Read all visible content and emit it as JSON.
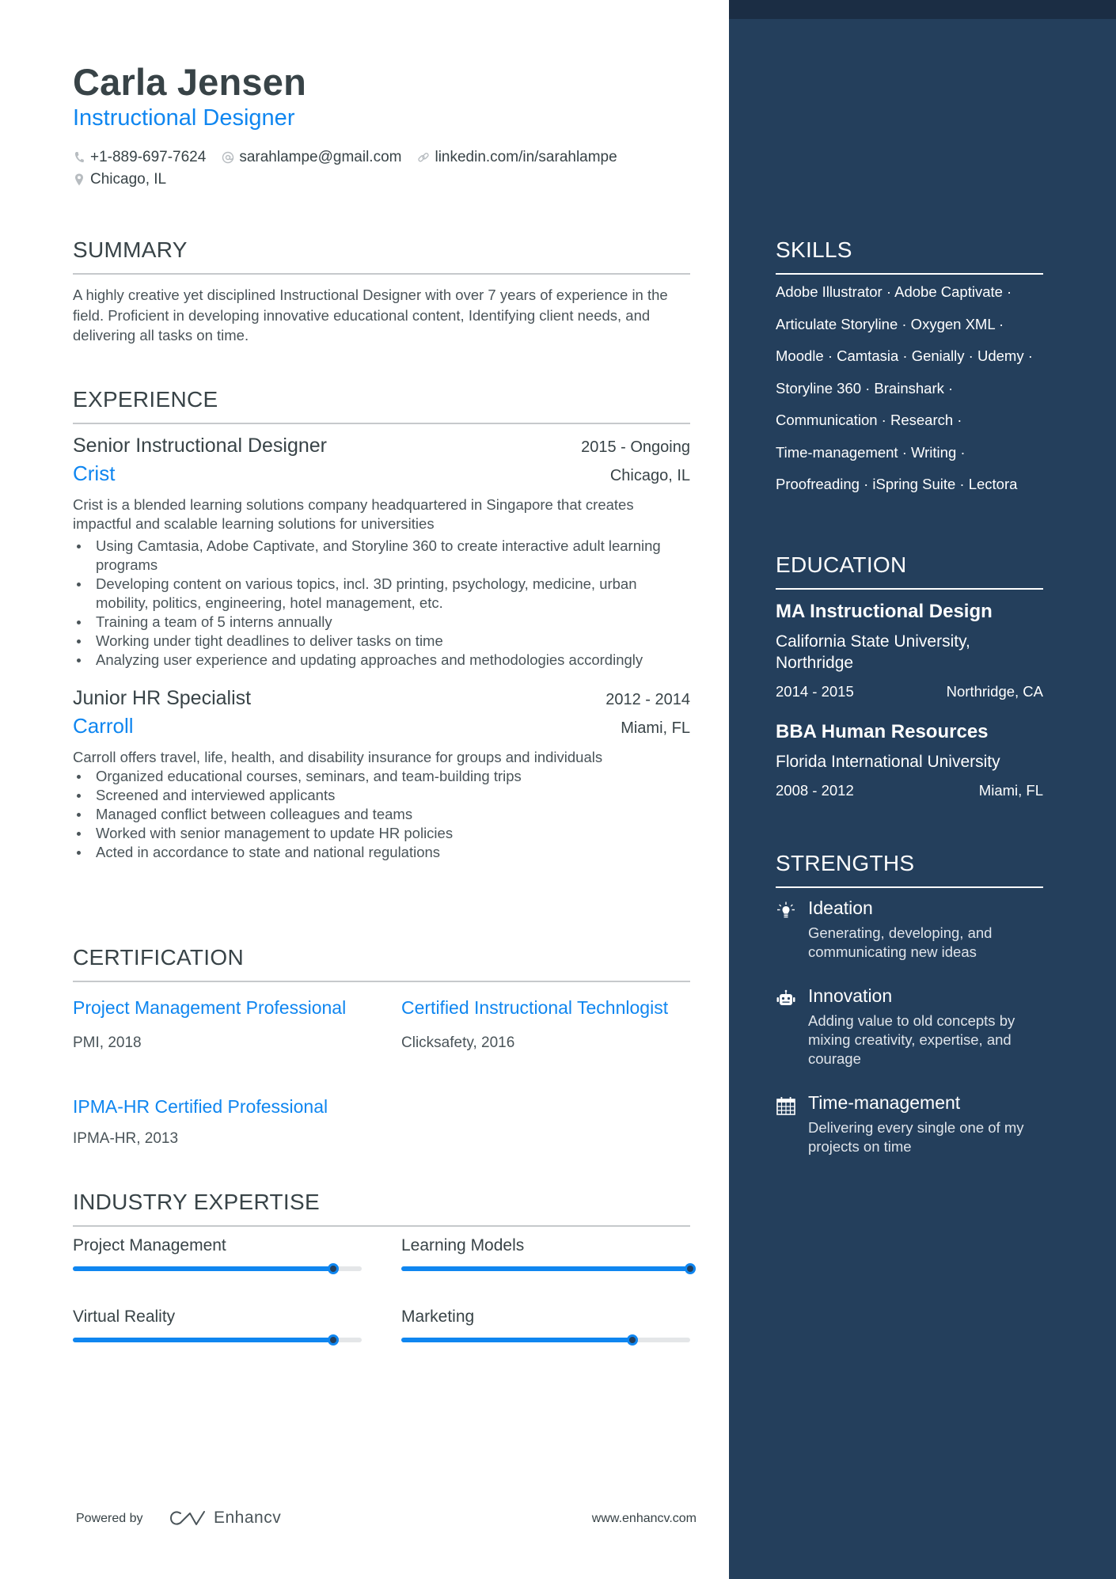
{
  "header": {
    "name": "Carla Jensen",
    "title": "Instructional Designer",
    "contacts": {
      "phone": "+1-889-697-7624",
      "email": "sarahlampe@gmail.com",
      "linkedin": "linkedin.com/in/sarahlampe",
      "location": "Chicago, IL"
    }
  },
  "summary": {
    "title": "SUMMARY",
    "text": "A highly creative yet disciplined Instructional Designer with over 7 years of experience in the field. Proficient in developing innovative educational content, Identifying client needs, and delivering all tasks on time."
  },
  "experience": {
    "title": "EXPERIENCE",
    "jobs": [
      {
        "role": "Senior Instructional Designer",
        "dates": "2015 - Ongoing",
        "company": "Crist",
        "location": "Chicago, IL",
        "description": "Crist is a blended learning solutions company headquartered in Singapore that creates impactful and scalable learning solutions for universities",
        "bullets": [
          "Using Camtasia, Adobe Captivate, and Storyline 360 to create interactive adult learning programs",
          "Developing content on various topics, incl. 3D printing, psychology, medicine, urban mobility, politics, engineering, hotel management, etc.",
          "Training a team of 5 interns annually",
          "Working under tight deadlines to deliver tasks on time",
          "Analyzing user experience and updating approaches and methodologies accordingly"
        ]
      },
      {
        "role": "Junior HR Specialist",
        "dates": "2012 - 2014",
        "company": "Carroll",
        "location": "Miami, FL",
        "description": "Carroll offers travel, life, health, and disability insurance for groups and individuals",
        "bullets": [
          "Organized educational courses, seminars, and team-building trips",
          "Screened and interviewed applicants",
          "Managed conflict between colleagues and teams",
          "Worked with senior management to update HR policies",
          "Acted in accordance to state and national regulations"
        ]
      }
    ]
  },
  "certification": {
    "title": "CERTIFICATION",
    "items": [
      {
        "name": "Project Management Professional",
        "issuer": "PMI, 2018"
      },
      {
        "name": "Certified Instructional Technlogist",
        "issuer": "Clicksafety, 2016"
      },
      {
        "name": "IPMA-HR Certified Professional",
        "issuer": "IPMA-HR, 2013"
      }
    ]
  },
  "expertise": {
    "title": "INDUSTRY EXPERTISE",
    "items": [
      {
        "label": "Project Management",
        "level": 0.9
      },
      {
        "label": "Learning Models",
        "level": 1.0
      },
      {
        "label": "Virtual Reality",
        "level": 0.9
      },
      {
        "label": "Marketing",
        "level": 0.8
      }
    ]
  },
  "skills": {
    "title": "SKILLS",
    "lines": [
      "Adobe Illustrator · Adobe Captivate ·",
      "Articulate Storyline · Oxygen XML ·",
      "Moodle · Camtasia · Genially · Udemy ·",
      "Storyline 360 · Brainshark ·",
      "Communication · Research ·",
      "Time-management · Writing  ·",
      "Proofreading · iSpring Suite · Lectora"
    ]
  },
  "education": {
    "title": "EDUCATION",
    "items": [
      {
        "degree": "MA Instructional Design",
        "school": "California State University, Northridge",
        "dates": "2014 - 2015",
        "location": "Northridge, CA"
      },
      {
        "degree": "BBA Human Resources",
        "school": "Florida International University",
        "dates": "2008 - 2012",
        "location": "Miami, FL"
      }
    ]
  },
  "strengths": {
    "title": "STRENGTHS",
    "items": [
      {
        "icon": "lightbulb-icon",
        "title": "Ideation",
        "description": "Generating, developing, and communicating new ideas"
      },
      {
        "icon": "robot-icon",
        "title": "Innovation",
        "description": "Adding value to old concepts by mixing creativity, expertise, and courage"
      },
      {
        "icon": "calendar-icon",
        "title": "Time-management",
        "description": "Delivering every single one of my projects on time"
      }
    ]
  },
  "footer": {
    "powered_by": "Powered by",
    "brand": "Enhancv",
    "website": "www.enhancv.com"
  },
  "colors": {
    "accent": "#0f86f0",
    "sidebar": "#243f5c",
    "sidebar_top": "#1b2d44",
    "text": "#384347"
  }
}
